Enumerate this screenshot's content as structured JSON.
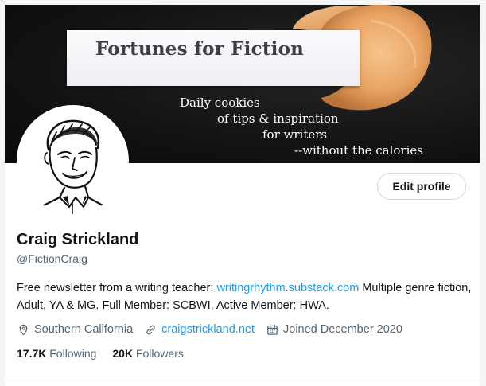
{
  "banner": {
    "title": "Fortunes for Fiction",
    "tagline_1": "Daily cookies",
    "tagline_2": "of tips & inspiration",
    "tagline_3": "for writers",
    "tagline_4": "--without the calories"
  },
  "profile": {
    "edit_label": "Edit profile",
    "name": "Craig Strickland",
    "handle": "@FictionCraig",
    "bio_prefix": "Free newsletter from a writing teacher: ",
    "bio_link": "writingrhythm.substack.com",
    "bio_suffix": " Multiple genre fiction, Adult, YA & MG. Full Member: SCBWI, Active Member: HWA.",
    "location": "Southern California",
    "website": "craigstrickland.net",
    "joined": "Joined December 2020",
    "following_count": "17.7K",
    "following_label": "Following",
    "followers_count": "20K",
    "followers_label": "Followers"
  },
  "icons": {
    "location": "location-pin-icon",
    "website": "link-icon",
    "joined": "calendar-icon"
  },
  "colors": {
    "accent": "#1d9bf0",
    "text_primary": "#0f1419",
    "text_secondary": "#536471",
    "button_border": "#cfd9de"
  }
}
